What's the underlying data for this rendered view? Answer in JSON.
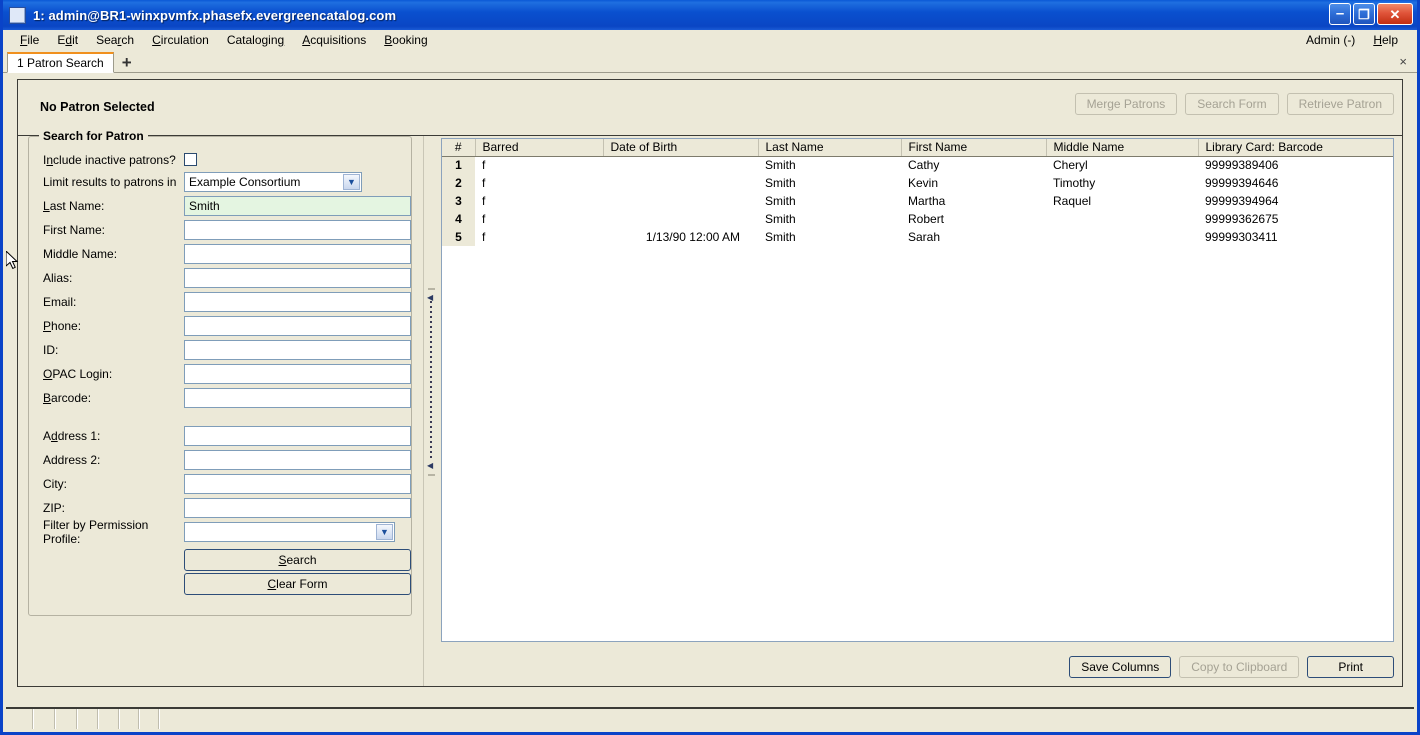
{
  "window": {
    "title": "1: admin@BR1-winxpvmfx.phasefx.evergreencatalog.com",
    "minimize_label": "–",
    "maximize_label": "❐",
    "close_label": "✕"
  },
  "menubar": {
    "items": [
      {
        "label": "File",
        "acc": "F"
      },
      {
        "label": "Edit",
        "acc": "E"
      },
      {
        "label": "Search",
        "acc": "r"
      },
      {
        "label": "Circulation",
        "acc": "C"
      },
      {
        "label": "Cataloging",
        "acc": "g"
      },
      {
        "label": "Acquisitions",
        "acc": "A"
      },
      {
        "label": "Booking",
        "acc": "B"
      }
    ],
    "admin_label": "Admin (-)",
    "help_label": "Help"
  },
  "tabs": {
    "active": "1 Patron Search",
    "new_tab_label": "+",
    "close_label": "×"
  },
  "patron_bar": {
    "status": "No Patron Selected",
    "buttons": [
      {
        "label": "Merge Patrons",
        "enabled": false
      },
      {
        "label": "Search Form",
        "enabled": false
      },
      {
        "label": "Retrieve Patron",
        "enabled": false
      }
    ]
  },
  "search_form": {
    "legend": "Search for Patron",
    "include_inactive_label": "Include inactive patrons?",
    "include_inactive_checked": false,
    "limit_label": "Limit results to patrons in",
    "limit_value": "Example Consortium",
    "fields": [
      {
        "label": "Last Name:",
        "value": "Smith",
        "focused": true
      },
      {
        "label": "First Name:",
        "value": "",
        "focused": false
      },
      {
        "label": "Middle Name:",
        "value": "",
        "focused": false
      },
      {
        "label": "Alias:",
        "value": "",
        "focused": false
      },
      {
        "label": "Email:",
        "value": "",
        "focused": false
      },
      {
        "label": "Phone:",
        "value": "",
        "focused": false
      },
      {
        "label": "ID:",
        "value": "",
        "focused": false
      },
      {
        "label": "OPAC Login:",
        "value": "",
        "focused": false
      },
      {
        "label": "Barcode:",
        "value": "",
        "focused": false
      }
    ],
    "address_fields": [
      {
        "label": "Address 1:",
        "value": ""
      },
      {
        "label": "Address 2:",
        "value": ""
      },
      {
        "label": "City:",
        "value": ""
      },
      {
        "label": "ZIP:",
        "value": ""
      }
    ],
    "permission_label": "Filter by Permission Profile:",
    "permission_value": "",
    "search_button": "Search",
    "clear_button": "Clear Form"
  },
  "results": {
    "columns": [
      "#",
      "Barred",
      "Date of Birth",
      "Last Name",
      "First Name",
      "Middle Name",
      "Library Card: Barcode"
    ],
    "rows": [
      {
        "num": "1",
        "barred": "f",
        "dob": "",
        "last": "Smith",
        "first": "Cathy",
        "middle": "Cheryl",
        "barcode": "99999389406"
      },
      {
        "num": "2",
        "barred": "f",
        "dob": "",
        "last": "Smith",
        "first": "Kevin",
        "middle": "Timothy",
        "barcode": "99999394646"
      },
      {
        "num": "3",
        "barred": "f",
        "dob": "",
        "last": "Smith",
        "first": "Martha",
        "middle": "Raquel",
        "barcode": "99999394964"
      },
      {
        "num": "4",
        "barred": "f",
        "dob": "",
        "last": "Smith",
        "first": "Robert",
        "middle": "",
        "barcode": "99999362675"
      },
      {
        "num": "5",
        "barred": "f",
        "dob": "1/13/90 12:00 AM",
        "last": "Smith",
        "first": "Sarah",
        "middle": "",
        "barcode": "99999303411"
      }
    ],
    "buttons": [
      {
        "label": "Save Columns",
        "enabled": true
      },
      {
        "label": "Copy to Clipboard",
        "enabled": false
      },
      {
        "label": "Print",
        "enabled": true
      }
    ]
  },
  "colors": {
    "titlebar_blue": "#0a50cf",
    "window_chrome": "#ece9d8",
    "tab_accent": "#f0901e",
    "focused_field": "#e4f5e1",
    "field_border": "#7f9db9"
  }
}
